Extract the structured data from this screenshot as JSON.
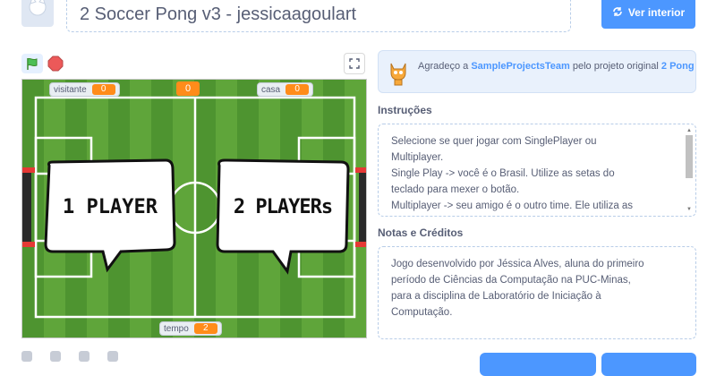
{
  "header": {
    "title": "2 Soccer Pong v3 - jessicaagoulart",
    "see_inside_label": "Ver interior"
  },
  "stage": {
    "hud_visitor_label": "visitante",
    "hud_visitor_value": "0",
    "hud_center_value": "0",
    "hud_home_label": "casa",
    "hud_home_value": "0",
    "hud_time_label": "tempo",
    "hud_time_value": "2",
    "bubble_left": "1 PLAYER",
    "bubble_right": "2 PLAYERs"
  },
  "credits": {
    "prefix": "Agradeço a ",
    "team": "SampleProjectsTeam",
    "middle": " pelo projeto original ",
    "project": "2 Pong"
  },
  "instructions": {
    "title": "Instruções",
    "lines": [
      "Selecione se quer jogar com SinglePlayer ou",
      "Multiplayer.",
      "Single Play -> você é o Brasil. Utilize as setas do",
      "teclado para mexer o botão.",
      "Multiplayer -> seu amigo é o outro time. Ele utiliza as"
    ]
  },
  "notes": {
    "title": "Notas e Créditos",
    "lines": [
      "Jogo desenvolvido por Jéssica Alves, aluna do primeiro",
      "período de Ciências da Computação na PUC-Minas,",
      "para a disciplina de Laboratório de Iniciação à",
      "Computação."
    ]
  },
  "colors": {
    "accent": "#4c97ff",
    "orange": "#ff8c1a",
    "grass_light": "#5fa53a",
    "grass_dark": "#4e9430"
  }
}
